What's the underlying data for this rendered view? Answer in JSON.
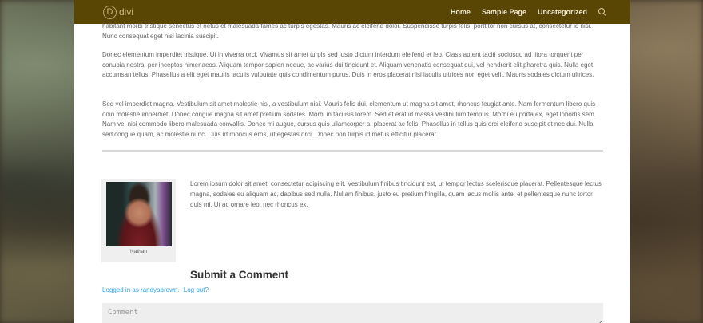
{
  "header": {
    "logo_letter": "D",
    "logo_text": "divi",
    "nav": [
      "Home",
      "Sample Page",
      "Uncategorized"
    ],
    "background": "#5a4604"
  },
  "article": {
    "paragraphs": [
      "habitant morbi tristique senectus et netus et malesuada fames ac turpis egestas. Mauris ac eleifend dolor. Suspendisse turpis felis, porttitor non cursus at, consectetur id nisi. Nunc consequat eget nisl lacinia suscipit.",
      "Donec elementum imperdiet tristique. Ut in viverra orci. Vivamus sit amet turpis sed justo dictum interdum eleifend et leo. Class aptent taciti sociosqu ad litora torquent per conubia nostra, per inceptos himenaeos. Aliquam tempor sapien neque, ac varius dui tincidunt et. Aliquam venenatis consequat dui, vel hendrerit elit pharetra quis. Nulla eget accumsan tellus. Phasellus a elit eget mauris iaculis vulputate quis condimentum purus. Duis in eros placerat nisi iaculis ultrices non eget velit. Mauris sodales dictum ultrices.",
      "Sed vel imperdiet magna. Vestibulum sit amet molestie nisl, a vestibulum nisi. Mauris felis dui, elementum ut magna sit amet, rhoncus feugiat ante. Nam fermentum libero quis odio molestie imperdiet. Donec congue magna sit amet pretium sodales. Morbi in facilisis lorem. Sed et erat id massa vestibulum tempus. Morbi eu porta ex, eget lobortis sem. Nam vel nisi commodo libero malesuada convallis. Donec mi augue, cursus quis ullamcorper a, placerat ac felis. Phasellus in tellus quis orci eleifend suscipit et nec dui. Nulla sed congue quam, ac molestie nunc. Duis id rhoncus eros, ut egestas orci. Donec non turpis id metus efficitur placerat."
    ]
  },
  "author": {
    "name": "Nathan",
    "bio": "Lorem ipsum dolor sit amet, consectetur adipiscing elit. Vestibulum finibus tincidunt est, ut tempor lectus scelerisque placerat. Pellentesque lectus magna, sodales eu aliquam ac, dapibus sed nulla. Nullam finibus, justo eu pretium fringilla, quam lacus mollis ante, et pellentesque nunc tortor quis mi. Ut ac ornare leo, nec rhoncus ex."
  },
  "comments": {
    "title": "Submit a Comment",
    "logged_in_text": "Logged in as randyabrown.",
    "logout_text": "Log out?",
    "comment_placeholder": "Comment"
  },
  "colors": {
    "link": "#2ea3f2",
    "text": "#666666"
  }
}
